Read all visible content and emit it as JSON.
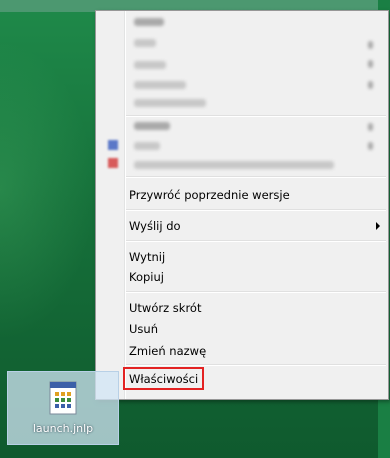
{
  "context_menu": {
    "items": [
      {
        "label": "Przywróć poprzednie wersje"
      },
      {
        "label": "Wyślij do",
        "has_submenu": true
      },
      {
        "label": "Wytnij"
      },
      {
        "label": "Kopiuj"
      },
      {
        "label": "Utwórz skrót"
      },
      {
        "label": "Usuń"
      },
      {
        "label": "Zmień nazwę"
      },
      {
        "label": "Właściwości",
        "highlighted": true
      }
    ]
  },
  "desktop": {
    "icon_label": "launch.jnlp"
  },
  "colors": {
    "menu_background": "#f0f0f0",
    "highlight_border": "#e32222",
    "desktop_background": "#16703a"
  }
}
